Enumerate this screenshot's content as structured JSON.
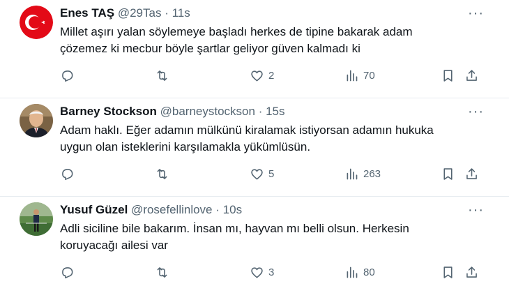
{
  "tweets": [
    {
      "name": "Enes TAŞ",
      "handle": "@29Tas",
      "dot": "·",
      "time": "11s",
      "text_lines": [
        "Millet aşırı yalan söylemeye başladı herkes de tipine bakarak adam",
        "çözemez ki mecbur böyle şartlar geliyor güven kalmadı ki"
      ],
      "likes": "2",
      "views": "70"
    },
    {
      "name": "Barney Stockson",
      "handle": "@barneystockson",
      "dot": "·",
      "time": "15s",
      "text_lines": [
        "Adam haklı. Eğer adamın mülkünü kiralamak istiyorsan adamın hukuka",
        "uygun olan isteklerini karşılamakla yükümlüsün."
      ],
      "likes": "5",
      "views": "263"
    },
    {
      "name": "Yusuf Güzel",
      "handle": "@rosefellinlove",
      "dot": "·",
      "time": "10s",
      "text_lines": [
        "Adli siciline bile bakarım. İnsan mı, hayvan mı belli olsun. Herkesin",
        "koruyacağı ailesi var"
      ],
      "likes": "3",
      "views": "80"
    }
  ],
  "more_glyph": "···",
  "colors": {
    "muted": "#536471",
    "text": "#0f1419",
    "flag_red": "#e30a17"
  }
}
